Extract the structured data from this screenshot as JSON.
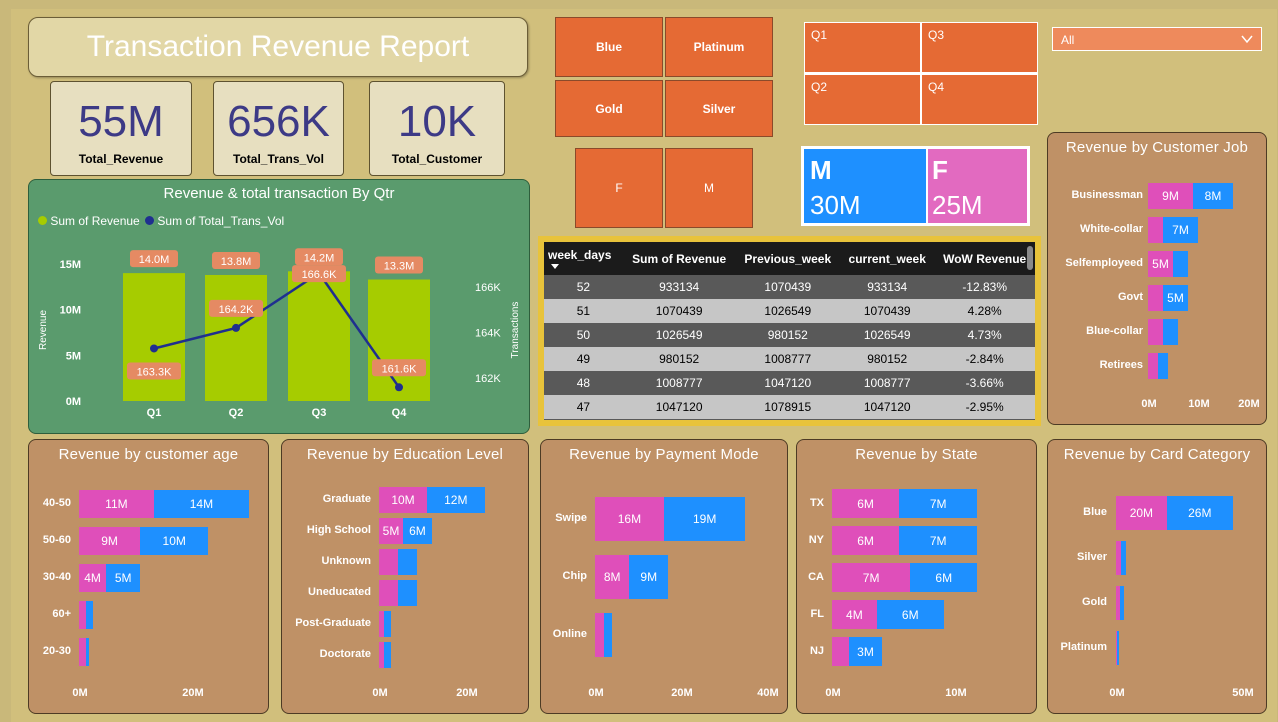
{
  "report_title": "Transaction Revenue Report",
  "kpis": [
    {
      "value": "55M",
      "label": "Total_Revenue"
    },
    {
      "value": "656K",
      "label": "Total_Trans_Vol"
    },
    {
      "value": "10K",
      "label": "Total_Customer"
    }
  ],
  "card_slicer": [
    "Blue",
    "Platinum",
    "Gold",
    "Silver"
  ],
  "gender_slicer": [
    "F",
    "M"
  ],
  "quarter_slicer": [
    "Q1",
    "Q3",
    "Q2",
    "Q4"
  ],
  "dropdown": {
    "value": "All"
  },
  "gender_card": {
    "m_label": "M",
    "m_value": "30M",
    "f_label": "F",
    "f_value": "25M",
    "m_color": "#1e90ff",
    "f_color": "#e26ac0"
  },
  "colors": {
    "pink": "#df4fba",
    "blue": "#1e90ff",
    "bar_green": "#a6cc00",
    "line_navy": "#1f2f8f",
    "card_bg": "#bf9166",
    "slicer_orange": "#e56a34"
  },
  "table": {
    "headers": [
      "week_days",
      "Sum of Revenue",
      "Previous_week",
      "current_week",
      "WoW Revenue"
    ],
    "rows": [
      [
        "52",
        "933134",
        "1070439",
        "933134",
        "-12.83%"
      ],
      [
        "51",
        "1070439",
        "1026549",
        "1070439",
        "4.28%"
      ],
      [
        "50",
        "1026549",
        "980152",
        "1026549",
        "4.73%"
      ],
      [
        "49",
        "980152",
        "1008777",
        "980152",
        "-2.84%"
      ],
      [
        "48",
        "1008777",
        "1047120",
        "1008777",
        "-3.66%"
      ],
      [
        "47",
        "1047120",
        "1078915",
        "1047120",
        "-2.95%"
      ]
    ]
  },
  "chart_data": [
    {
      "type": "bar",
      "title": "Revenue & total transaction By Qtr",
      "legend": [
        "Sum of Revenue",
        "Sum of Total_Trans_Vol"
      ],
      "categories": [
        "Q1",
        "Q2",
        "Q3",
        "Q4"
      ],
      "series": [
        {
          "name": "Sum of Revenue",
          "values": [
            14.0,
            13.8,
            14.2,
            13.3
          ],
          "labels": [
            "14.0M",
            "13.8M",
            "14.2M",
            "13.3M"
          ]
        },
        {
          "name": "Sum of Total_Trans_Vol",
          "values": [
            163.3,
            164.2,
            166.6,
            161.6
          ],
          "labels": [
            "163.3K",
            "164.2K",
            "166.6K",
            "161.6K"
          ]
        }
      ],
      "ylabel": "Revenue",
      "y2label": "Transactions",
      "y_ticks": [
        "15M",
        "10M",
        "5M",
        "0M"
      ],
      "y2_ticks": [
        "166K",
        "164K",
        "162K"
      ],
      "ylim": [
        0,
        15
      ],
      "y2lim": [
        161,
        167
      ]
    },
    {
      "type": "bar",
      "title": "Revenue by Customer Job",
      "categories": [
        "Businessman",
        "White-collar",
        "Selfemployeed",
        "Govt",
        "Blue-collar",
        "Retirees"
      ],
      "series": [
        {
          "values": [
            9,
            3,
            5,
            3,
            3,
            2
          ],
          "labels": [
            "9M",
            "",
            "5M",
            "",
            "",
            ""
          ]
        },
        {
          "values": [
            8,
            7,
            3,
            5,
            3,
            2
          ],
          "labels": [
            "8M",
            "7M",
            "",
            "5M",
            "",
            ""
          ]
        }
      ],
      "x_ticks": [
        "0M",
        "10M",
        "20M"
      ],
      "xlim": [
        0,
        20
      ]
    },
    {
      "type": "bar",
      "title": "Revenue by customer age",
      "categories": [
        "40-50",
        "50-60",
        "30-40",
        "60+",
        "20-30"
      ],
      "series": [
        {
          "values": [
            11,
            9,
            4,
            1,
            1
          ],
          "labels": [
            "11M",
            "9M",
            "4M",
            "",
            ""
          ]
        },
        {
          "values": [
            14,
            10,
            5,
            1,
            0.5
          ],
          "labels": [
            "14M",
            "10M",
            "5M",
            "",
            ""
          ]
        }
      ],
      "x_ticks": [
        "0M",
        "20M"
      ],
      "xlim": [
        0,
        25
      ]
    },
    {
      "type": "bar",
      "title": "Revenue by Education Level",
      "categories": [
        "Graduate",
        "High School",
        "Unknown",
        "Uneducated",
        "Post-Graduate",
        "Doctorate"
      ],
      "series": [
        {
          "values": [
            10,
            5,
            4,
            4,
            1,
            1
          ],
          "labels": [
            "10M",
            "5M",
            "",
            "",
            "",
            ""
          ]
        },
        {
          "values": [
            12,
            6,
            4,
            4,
            1.5,
            1.5
          ],
          "labels": [
            "12M",
            "6M",
            "",
            "",
            "",
            ""
          ]
        }
      ],
      "x_ticks": [
        "0M",
        "20M"
      ],
      "xlim": [
        0,
        25
      ]
    },
    {
      "type": "bar",
      "title": "Revenue by Payment Mode",
      "categories": [
        "Swipe",
        "Chip",
        "Online"
      ],
      "series": [
        {
          "values": [
            16,
            8,
            2
          ],
          "labels": [
            "16M",
            "8M",
            ""
          ]
        },
        {
          "values": [
            19,
            9,
            2
          ],
          "labels": [
            "19M",
            "9M",
            ""
          ]
        }
      ],
      "x_ticks": [
        "0M",
        "20M",
        "40M"
      ],
      "xlim": [
        0,
        40
      ]
    },
    {
      "type": "bar",
      "title": "Revenue by State",
      "categories": [
        "TX",
        "NY",
        "CA",
        "FL",
        "NJ"
      ],
      "series": [
        {
          "values": [
            6,
            6,
            7,
            4,
            1.5
          ],
          "labels": [
            "6M",
            "6M",
            "7M",
            "4M",
            ""
          ]
        },
        {
          "values": [
            7,
            7,
            6,
            6,
            3
          ],
          "labels": [
            "7M",
            "7M",
            "6M",
            "6M",
            "3M"
          ]
        }
      ],
      "x_ticks": [
        "0M",
        "10M"
      ],
      "xlim": [
        0,
        17
      ]
    },
    {
      "type": "bar",
      "title": "Revenue by Card Category",
      "categories": [
        "Blue",
        "Silver",
        "Gold",
        "Platinum"
      ],
      "series": [
        {
          "values": [
            20,
            2,
            1.5,
            0.5
          ],
          "labels": [
            "20M",
            "",
            "",
            ""
          ]
        },
        {
          "values": [
            26,
            2,
            1.5,
            0.5
          ],
          "labels": [
            "26M",
            "",
            "",
            ""
          ]
        }
      ],
      "x_ticks": [
        "0M",
        "50M"
      ],
      "xlim": [
        0,
        52
      ]
    }
  ]
}
